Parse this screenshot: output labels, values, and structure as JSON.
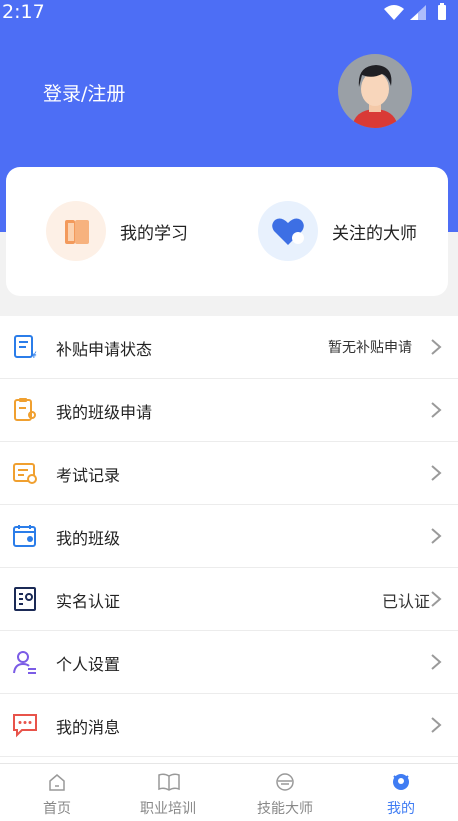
{
  "status_bar": {
    "time": "2:17"
  },
  "profile": {
    "login_label": "登录/注册"
  },
  "quick_links": [
    {
      "label": "我的学习",
      "icon": "book-icon"
    },
    {
      "label": "关注的大师",
      "icon": "heart-icon"
    }
  ],
  "menu": [
    {
      "label": "补贴申请状态",
      "value": "暂无补贴申请",
      "icon": "subsidy-form-icon"
    },
    {
      "label": "我的班级申请",
      "value": "",
      "icon": "class-application-icon"
    },
    {
      "label": "考试记录",
      "value": "",
      "icon": "exam-record-icon"
    },
    {
      "label": "我的班级",
      "value": "",
      "icon": "class-calendar-icon"
    },
    {
      "label": "实名认证",
      "value": "已认证",
      "icon": "id-card-icon"
    },
    {
      "label": "个人设置",
      "value": "",
      "icon": "person-settings-icon"
    },
    {
      "label": "我的消息",
      "value": "",
      "icon": "message-icon"
    }
  ],
  "tabs": [
    {
      "label": "首页",
      "active": false
    },
    {
      "label": "职业培训",
      "active": false
    },
    {
      "label": "技能大师",
      "active": false
    },
    {
      "label": "我的",
      "active": true
    }
  ],
  "colors": {
    "header": "#4d6ef5",
    "active_tab": "#3f7cf3"
  }
}
